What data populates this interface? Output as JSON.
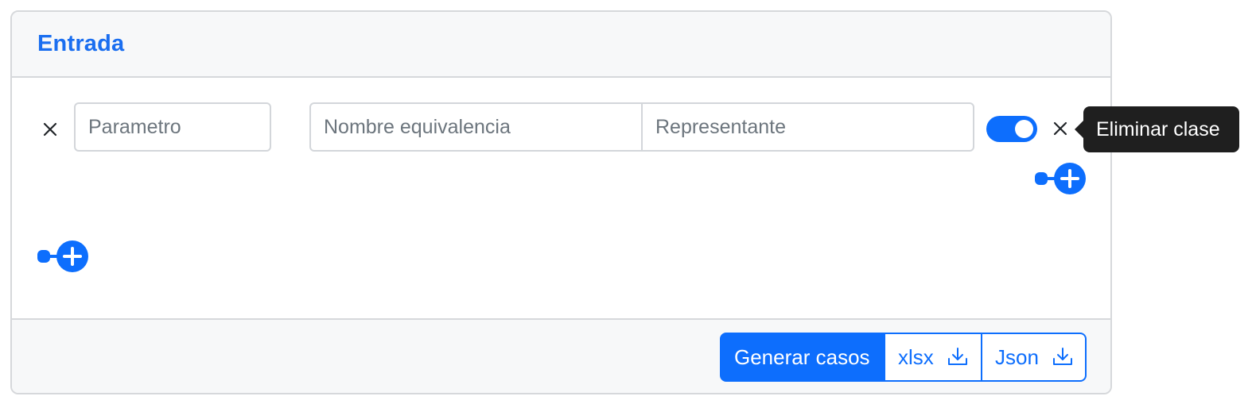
{
  "card": {
    "title": "Entrada"
  },
  "parameter": {
    "placeholder": "Parametro",
    "value": ""
  },
  "equivalence_class": {
    "name_placeholder": "Nombre equivalencia",
    "representative_placeholder": "Representante",
    "toggle_on": true
  },
  "tooltip": {
    "text": "Eliminar clase"
  },
  "footer": {
    "generate_label": "Generar casos",
    "xlsx_label": "xlsx",
    "json_label": "Json"
  },
  "icons": {
    "remove_parameter": "close-icon",
    "remove_class": "close-icon",
    "add_class": "plus-circle-icon",
    "add_parameter": "plus-circle-icon",
    "download": "download-icon"
  },
  "colors": {
    "accent": "#0d6efd",
    "title": "#1a6ef0",
    "tooltip_bg": "#1f1f1f",
    "header_bg": "#f7f8f9",
    "border": "#d6d8db"
  }
}
